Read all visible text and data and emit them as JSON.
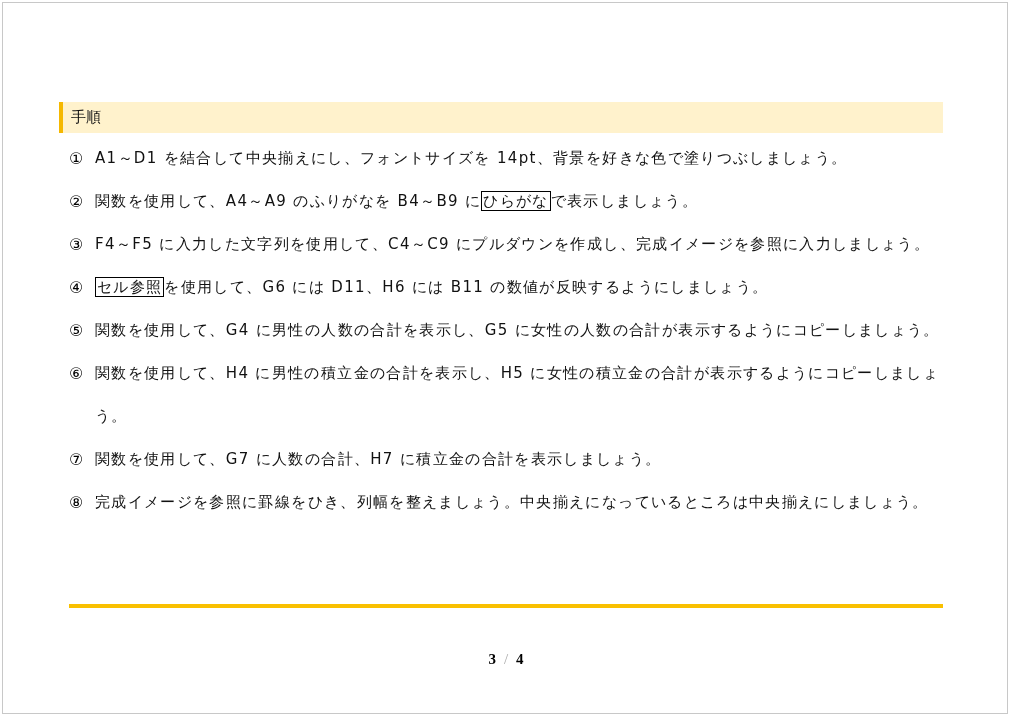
{
  "section": {
    "heading": "手順"
  },
  "steps": [
    {
      "number": "①",
      "segments": [
        {
          "text": "A1～D1 を結合して中央揃えにし、フォントサイズを 14pt、背景を好きな色で塗りつぶしましょう。",
          "boxed": false
        }
      ]
    },
    {
      "number": "②",
      "segments": [
        {
          "text": "関数を使用して、A4～A9 のふりがなを B4～B9 に",
          "boxed": false
        },
        {
          "text": "ひらがな",
          "boxed": true
        },
        {
          "text": "で表示しましょう。",
          "boxed": false
        }
      ]
    },
    {
      "number": "③",
      "segments": [
        {
          "text": "F4～F5 に入力した文字列を使用して、C4～C9 にプルダウンを作成し、完成イメージを参照に入力しましょう。",
          "boxed": false
        }
      ]
    },
    {
      "number": "④",
      "segments": [
        {
          "text": "セル参照",
          "boxed": true
        },
        {
          "text": "を使用して、G6 には D11、H6 には B11 の数値が反映するようにしましょう。",
          "boxed": false
        }
      ]
    },
    {
      "number": "⑤",
      "segments": [
        {
          "text": "関数を使用して、G4 に男性の人数の合計を表示し、G5 に女性の人数の合計が表示するようにコピーしましょう。",
          "boxed": false
        }
      ]
    },
    {
      "number": "⑥",
      "segments": [
        {
          "text": "関数を使用して、H4 に男性の積立金の合計を表示し、H5 に女性の積立金の合計が表示するようにコピーしましょう。",
          "boxed": false
        }
      ]
    },
    {
      "number": "⑦",
      "segments": [
        {
          "text": "関数を使用して、G7 に人数の合計、H7 に積立金の合計を表示しましょう。",
          "boxed": false
        }
      ]
    },
    {
      "number": "⑧",
      "segments": [
        {
          "text": "完成イメージを参照に罫線をひき、列幅を整えましょう。中央揃えになっているところは中央揃えにしましょう。",
          "boxed": false
        }
      ]
    }
  ],
  "footer": {
    "page": "3",
    "separator": "/",
    "total": "4"
  }
}
